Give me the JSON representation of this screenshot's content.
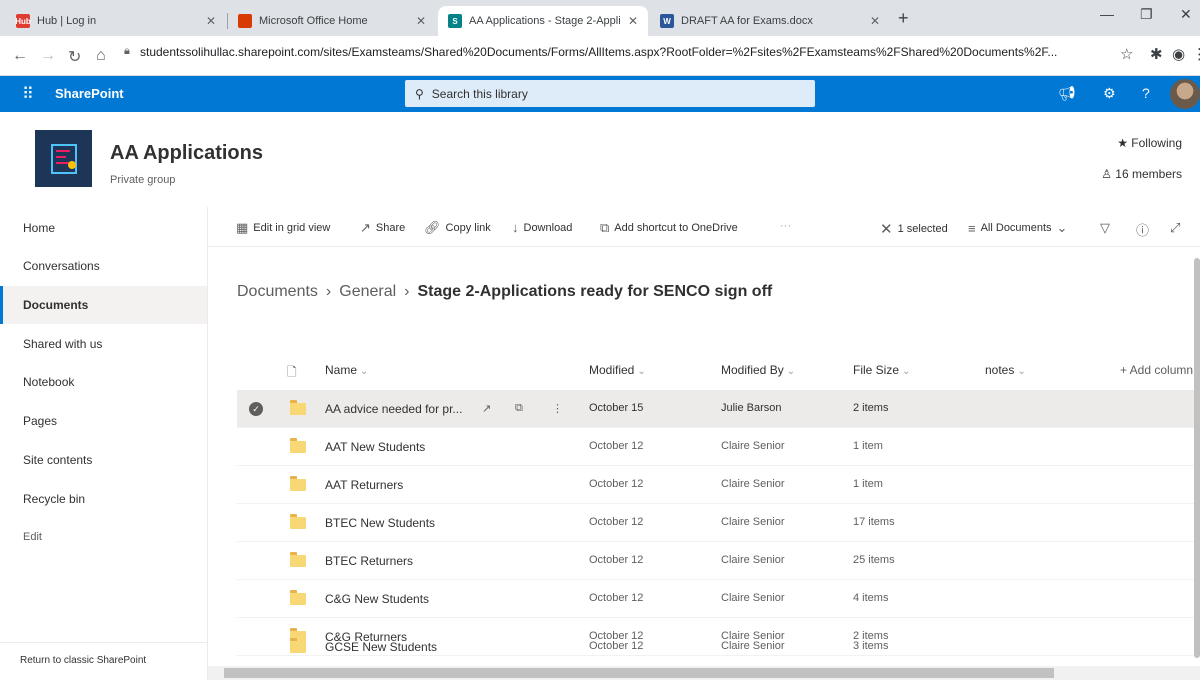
{
  "browser": {
    "tabs": [
      {
        "title": "Hub | Log in",
        "favicon_color": "#e03c31"
      },
      {
        "title": "Microsoft Office Home",
        "favicon_color": "#d83b01"
      },
      {
        "title": "AA Applications - Stage 2-Applic",
        "favicon_color": "#038387"
      },
      {
        "title": "DRAFT AA for Exams.docx",
        "favicon_color": "#2b579a"
      }
    ],
    "url": "studentssolihullac.sharepoint.com/sites/Examsteams/Shared%20Documents/Forms/AllItems.aspx?RootFolder=%2Fsites%2FExamsteams%2FShared%20Documents%2F..."
  },
  "suitebar": {
    "app_name": "SharePoint",
    "search_placeholder": "Search this library",
    "accent": "#0078d4"
  },
  "site": {
    "name": "AA Applications",
    "subtitle": "Private group",
    "following": "Following",
    "members": "16 members"
  },
  "nav": {
    "items": [
      "Home",
      "Conversations",
      "Documents",
      "Shared with us",
      "Notebook",
      "Pages",
      "Site contents",
      "Recycle bin"
    ],
    "edit": "Edit",
    "classic": "Return to classic SharePoint"
  },
  "commands": {
    "edit_grid": "Edit in grid view",
    "share": "Share",
    "copy_link": "Copy link",
    "download": "Download",
    "add_shortcut": "Add shortcut to OneDrive",
    "selected": "1 selected",
    "view": "All Documents"
  },
  "breadcrumb": {
    "root": "Documents",
    "middle": "General",
    "current": "Stage 2-Applications ready for SENCO sign off"
  },
  "columns": {
    "name": "Name",
    "modified": "Modified",
    "modified_by": "Modified By",
    "file_size": "File Size",
    "notes": "notes",
    "add_column": "+ Add column"
  },
  "rows": [
    {
      "name": "AA advice needed for pr...",
      "modified": "October 15",
      "by": "Julie Barson",
      "size": "2 items"
    },
    {
      "name": "AAT New Students",
      "modified": "October 12",
      "by": "Claire Senior",
      "size": "1 item"
    },
    {
      "name": "AAT Returners",
      "modified": "October 12",
      "by": "Claire Senior",
      "size": "1 item"
    },
    {
      "name": "BTEC New Students",
      "modified": "October 12",
      "by": "Claire Senior",
      "size": "17 items"
    },
    {
      "name": "BTEC Returners",
      "modified": "October 12",
      "by": "Claire Senior",
      "size": "25 items"
    },
    {
      "name": "C&G New Students",
      "modified": "October 12",
      "by": "Claire Senior",
      "size": "4 items"
    },
    {
      "name": "C&G Returners",
      "modified": "October 12",
      "by": "Claire Senior",
      "size": "2 items"
    },
    {
      "name": "GCSE New Students",
      "modified": "October 12",
      "by": "Claire Senior",
      "size": "3 items"
    }
  ]
}
